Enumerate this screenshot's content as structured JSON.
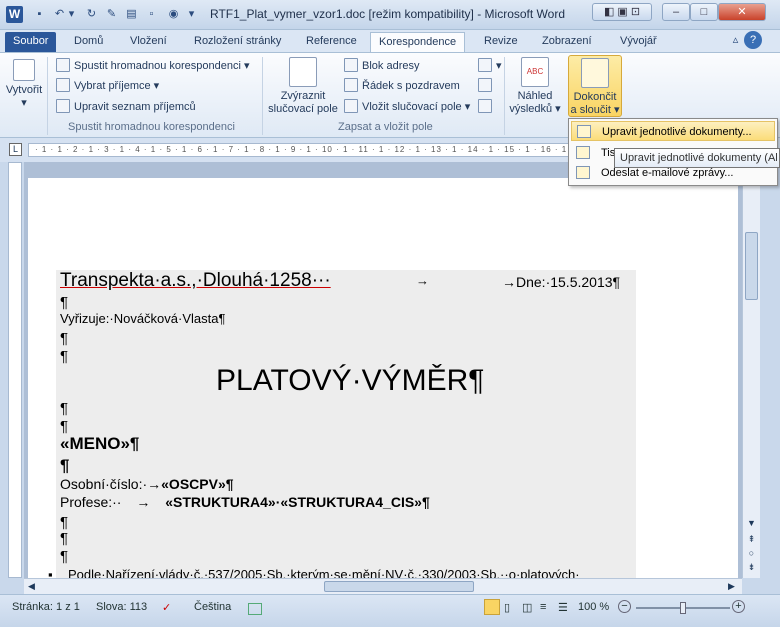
{
  "window": {
    "title": "RTF1_Plat_vymer_vzor1.doc [režim kompatibility] - Microsoft Word",
    "app_logo": "W"
  },
  "tabs": [
    {
      "label": "Soubor"
    },
    {
      "label": "Domů"
    },
    {
      "label": "Vložení"
    },
    {
      "label": "Rozložení stránky"
    },
    {
      "label": "Reference"
    },
    {
      "label": "Korespondence"
    },
    {
      "label": "Revize"
    },
    {
      "label": "Zobrazení"
    },
    {
      "label": "Vývojář"
    }
  ],
  "ribbon": {
    "create": "Vytvořit",
    "start": {
      "start_merge": "Spustit hromadnou korespondenci",
      "select_recipients": "Vybrat příjemce",
      "edit_list": "Upravit seznam příjemců",
      "group": "Spustit hromadnou korespondenci"
    },
    "insert": {
      "highlight_l1": "Zvýraznit",
      "highlight_l2": "slučovací pole",
      "address_block": "Blok adresy",
      "greeting": "Řádek s pozdravem",
      "merge_field": "Vložit slučovací pole",
      "group": "Zapsat a vložit pole"
    },
    "preview": {
      "l1": "Náhled",
      "l2": "výsledků",
      "abc": "ABC"
    },
    "finish": {
      "l1": "Dokončit",
      "l2": "a sloučit"
    }
  },
  "dropdown": {
    "items": [
      {
        "label": "Upravit jednotlivé dokumenty..."
      },
      {
        "label": "Tis"
      },
      {
        "label": "Odeslat e-mailové zprávy..."
      }
    ],
    "tooltip": "Upravit jednotlivé dokumenty (Al"
  },
  "ruler": {
    "ticks": "· 1 · 1 · 2 · 1 · 3 · 1 · 4 · 1 · 5 · 1 · 6 · 1 · 7 · 1 · 8 · 1 · 9 · 1 · 10 · 1 · 11 · 1 · 12 · 1 · 13 · 1 · 14 · 1 · 15 · 1 · 16 · 1 · 17 · 1 · 18"
  },
  "document": {
    "company": "Transpekta·a.s.,·Dlouhá·1258···",
    "arrow": "→",
    "date": "→Dne:·15.5.2013¶",
    "para": "¶",
    "handled_by": "Vyřizuje:·Nováčková·Vlasta¶",
    "heading": "PLATOVÝ·VÝMĚR¶",
    "name_field": "«MENO»¶",
    "bold_para": "¶",
    "personal_no_label": "Osobní·číslo:·→",
    "personal_no_field": "«OSCPV»¶",
    "profession_label": "Profese:··",
    "profession_field": "«STRUKTURA4»·«STRUKTURA4_CIS»¶",
    "last_line": "Podle·Nařízení·vlády·č.·537/2005·Sb.·kterým·se·mění·NV·č.·330/2003·Sb.··o·platových·"
  },
  "status": {
    "page": "Stránka: 1 z 1",
    "words": "Slova: 113",
    "language": "Čeština",
    "zoom": "100 %",
    "zoom_level": 0.5
  }
}
